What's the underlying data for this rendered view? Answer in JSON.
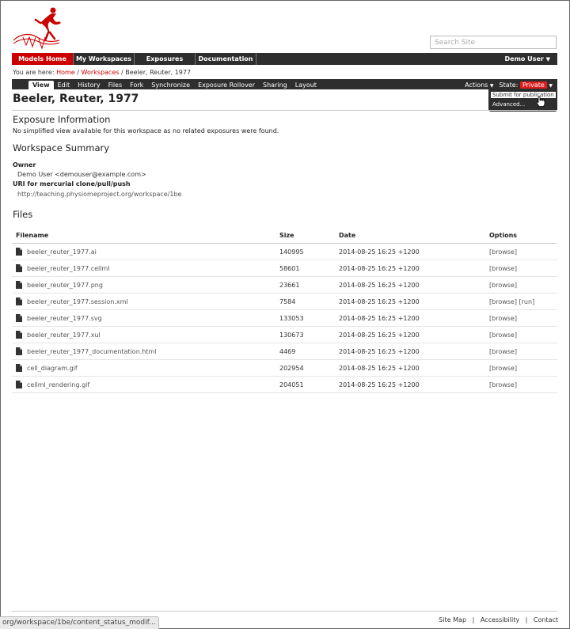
{
  "search": {
    "placeholder": "Search Site"
  },
  "mainnav": {
    "items": [
      {
        "label": "Models Home"
      },
      {
        "label": "My Workspaces"
      },
      {
        "label": "Exposures"
      },
      {
        "label": "Documentation"
      }
    ],
    "user": "Demo User"
  },
  "breadcrumb": {
    "prefix": "You are here:",
    "home": "Home",
    "workspaces": "Workspaces",
    "current": "Beeler, Reuter, 1977",
    "sep": "/"
  },
  "ctx": {
    "tabs": [
      "View",
      "Edit",
      "History",
      "Files",
      "Fork",
      "Synchronize",
      "Exposure Rollover",
      "Sharing",
      "Layout"
    ],
    "actions": "Actions",
    "state_label": "State:",
    "state_value": "Private",
    "state_color": "#e01b1b",
    "dropdown": [
      "Submit for publication",
      "Advanced..."
    ]
  },
  "page": {
    "title": "Beeler, Reuter, 1977",
    "exposure_heading": "Exposure Information",
    "exposure_text": "No simplified view available for this workspace as no related exposures were found.",
    "summary_heading": "Workspace Summary",
    "owner_label": "Owner",
    "owner_value": "Demo User <demouser@example.com>",
    "uri_label": "URI for mercurial clone/pull/push",
    "uri_value": "http://teaching.physiomeproject.org/workspace/1be",
    "files_heading": "Files"
  },
  "files": {
    "headers": {
      "filename": "Filename",
      "size": "Size",
      "date": "Date",
      "options": "Options"
    },
    "rows": [
      {
        "name": "beeler_reuter_1977.ai",
        "size": "140995",
        "date": "2014-08-25 16:25 +1200",
        "browse": "[browse]",
        "run": ""
      },
      {
        "name": "beeler_reuter_1977.cellml",
        "size": "58601",
        "date": "2014-08-25 16:25 +1200",
        "browse": "[browse]",
        "run": ""
      },
      {
        "name": "beeler_reuter_1977.png",
        "size": "23661",
        "date": "2014-08-25 16:25 +1200",
        "browse": "[browse]",
        "run": ""
      },
      {
        "name": "beeler_reuter_1977.session.xml",
        "size": "7584",
        "date": "2014-08-25 16:25 +1200",
        "browse": "[browse]",
        "run": "[run]"
      },
      {
        "name": "beeler_reuter_1977.svg",
        "size": "133053",
        "date": "2014-08-25 16:25 +1200",
        "browse": "[browse]",
        "run": ""
      },
      {
        "name": "beeler_reuter_1977.xul",
        "size": "130673",
        "date": "2014-08-25 16:25 +1200",
        "browse": "[browse]",
        "run": ""
      },
      {
        "name": "beeler_reuter_1977_documentation.html",
        "size": "4469",
        "date": "2014-08-25 16:25 +1200",
        "browse": "[browse]",
        "run": ""
      },
      {
        "name": "cell_diagram.gif",
        "size": "202954",
        "date": "2014-08-25 16:25 +1200",
        "browse": "[browse]",
        "run": ""
      },
      {
        "name": "cellml_rendering.gif",
        "size": "204051",
        "date": "2014-08-25 16:25 +1200",
        "browse": "[browse]",
        "run": ""
      }
    ]
  },
  "footer": {
    "links": [
      "Site Map",
      "Accessibility",
      "Contact"
    ],
    "sep": "|"
  },
  "statusbar": {
    "text": "org/workspace/1be/content_status_modif..."
  }
}
